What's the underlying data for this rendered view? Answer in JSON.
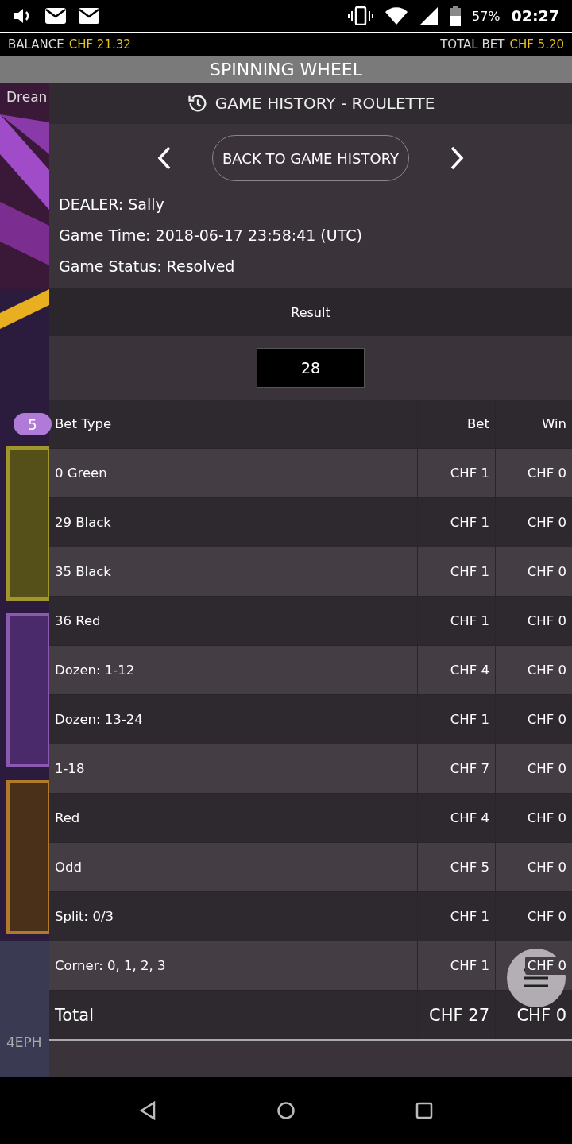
{
  "status_bar": {
    "battery": "57%",
    "time": "02:27"
  },
  "balance_bar": {
    "balance_label": "BALANCE",
    "balance_value": "CHF 21.32",
    "bet_label": "TOTAL BET",
    "bet_value": "CHF 5.20"
  },
  "title": "SPINNING WHEEL",
  "background": {
    "label": "Drean",
    "badge": "5",
    "footer": "4EPH"
  },
  "history": {
    "title": "GAME HISTORY - ROULETTE",
    "back_button": "BACK TO GAME HISTORY",
    "details": [
      "DEALER: Sally",
      "Game Time: 2018-06-17 23:58:41 (UTC)",
      "Game Status: Resolved"
    ],
    "result_label": "Result",
    "result": "28",
    "columns": [
      "Bet Type",
      "Bet",
      "Win"
    ],
    "rows": [
      {
        "type": "0 Green",
        "bet": "CHF 1",
        "win": "CHF 0"
      },
      {
        "type": "29 Black",
        "bet": "CHF 1",
        "win": "CHF 0"
      },
      {
        "type": "35 Black",
        "bet": "CHF 1",
        "win": "CHF 0"
      },
      {
        "type": "36 Red",
        "bet": "CHF 1",
        "win": "CHF 0"
      },
      {
        "type": "Dozen: 1-12",
        "bet": "CHF 4",
        "win": "CHF 0"
      },
      {
        "type": "Dozen: 13-24",
        "bet": "CHF 1",
        "win": "CHF 0"
      },
      {
        "type": "1-18",
        "bet": "CHF 7",
        "win": "CHF 0"
      },
      {
        "type": "Red",
        "bet": "CHF 4",
        "win": "CHF 0"
      },
      {
        "type": "Odd",
        "bet": "CHF 5",
        "win": "CHF 0"
      },
      {
        "type": "Split: 0/3",
        "bet": "CHF 1",
        "win": "CHF 0"
      },
      {
        "type": "Corner: 0, 1, 2, 3",
        "bet": "CHF 1",
        "win": "CHF 0"
      }
    ],
    "total": {
      "label": "Total",
      "bet": "CHF 27",
      "win": "CHF 0"
    }
  }
}
